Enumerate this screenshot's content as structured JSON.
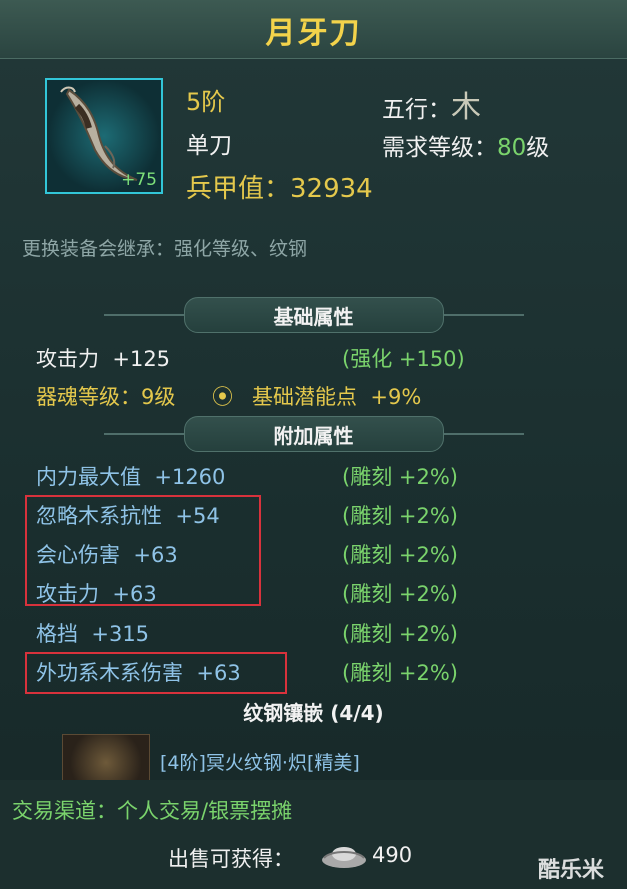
{
  "item": {
    "name": "月牙刀",
    "tier": "5阶",
    "type": "单刀",
    "element_label": "五行：",
    "element_glyph": "木",
    "req_label": "需求等级：",
    "req_value": "80",
    "req_unit": "级",
    "armor_label": "兵甲值：",
    "armor_value": "32934",
    "enhance": "+75",
    "inherit_note": "更换装备会继承：强化等级、纹钢"
  },
  "basic": {
    "header": "基础属性",
    "attack_label": "攻击力",
    "attack_value": "+125",
    "attack_bonus": "(强化 +150)",
    "soul_label": "器魂等级：",
    "soul_value": "9级",
    "potential_label": "基础潜能点",
    "potential_value": "+9%"
  },
  "extra": {
    "header": "附加属性",
    "rows": [
      {
        "label": "内力最大值",
        "value": "+1260",
        "bonus": "(雕刻 +2%)"
      },
      {
        "label": "忽略木系抗性",
        "value": "+54",
        "bonus": "(雕刻 +2%)"
      },
      {
        "label": "会心伤害",
        "value": "+63",
        "bonus": "(雕刻 +2%)"
      },
      {
        "label": "攻击力",
        "value": "+63",
        "bonus": "(雕刻 +2%)"
      },
      {
        "label": "格挡",
        "value": "+315",
        "bonus": "(雕刻 +2%)"
      },
      {
        "label": "外功系木系伤害",
        "value": "+63",
        "bonus": "(雕刻 +2%)"
      }
    ]
  },
  "steel": {
    "header": "纹钢镶嵌 (4/4)",
    "item_text": "[4阶]冥火纹钢·炽[精美]"
  },
  "trade": {
    "channel": "交易渠道：个人交易/银票摆摊",
    "sell_label": "出售可获得：",
    "sell_value": "490"
  },
  "watermark": "酷乐米"
}
